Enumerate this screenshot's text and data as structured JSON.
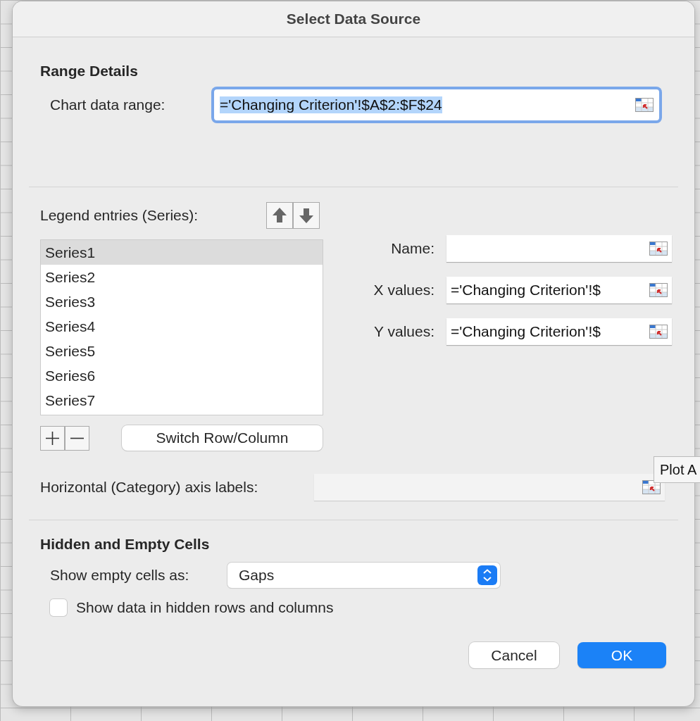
{
  "window": {
    "title": "Select Data Source"
  },
  "range_details": {
    "heading": "Range Details",
    "label": "Chart data range:",
    "value": "='Changing Criterion'!$A$2:$F$24",
    "focused": true
  },
  "legend": {
    "label": "Legend entries (Series):",
    "series": [
      {
        "label": "Series1",
        "selected": true
      },
      {
        "label": "Series2",
        "selected": false
      },
      {
        "label": "Series3",
        "selected": false
      },
      {
        "label": "Series4",
        "selected": false
      },
      {
        "label": "Series5",
        "selected": false
      },
      {
        "label": "Series6",
        "selected": false
      },
      {
        "label": "Series7",
        "selected": false
      }
    ],
    "fields": [
      {
        "label": "Name:"
      },
      {
        "label": "X values:",
        "value": "='Changing Criterion'!$"
      },
      {
        "label": "Y values:",
        "value": "='Changing Criterion'!$"
      }
    ],
    "switch_button": "Switch Row/Column"
  },
  "axis_labels": {
    "label": "Horizontal (Category) axis labels:",
    "disabled": true
  },
  "tooltip": {
    "text": "Plot A"
  },
  "hidden_empty": {
    "heading": "Hidden and Empty Cells",
    "label": "Show empty cells as:",
    "value": "Gaps",
    "checkbox": {
      "label": "Show data in hidden rows and columns",
      "checked": false
    }
  },
  "buttons": [
    {
      "label": "Cancel",
      "kind": "secondary"
    },
    {
      "label": "OK",
      "kind": "primary"
    }
  ]
}
